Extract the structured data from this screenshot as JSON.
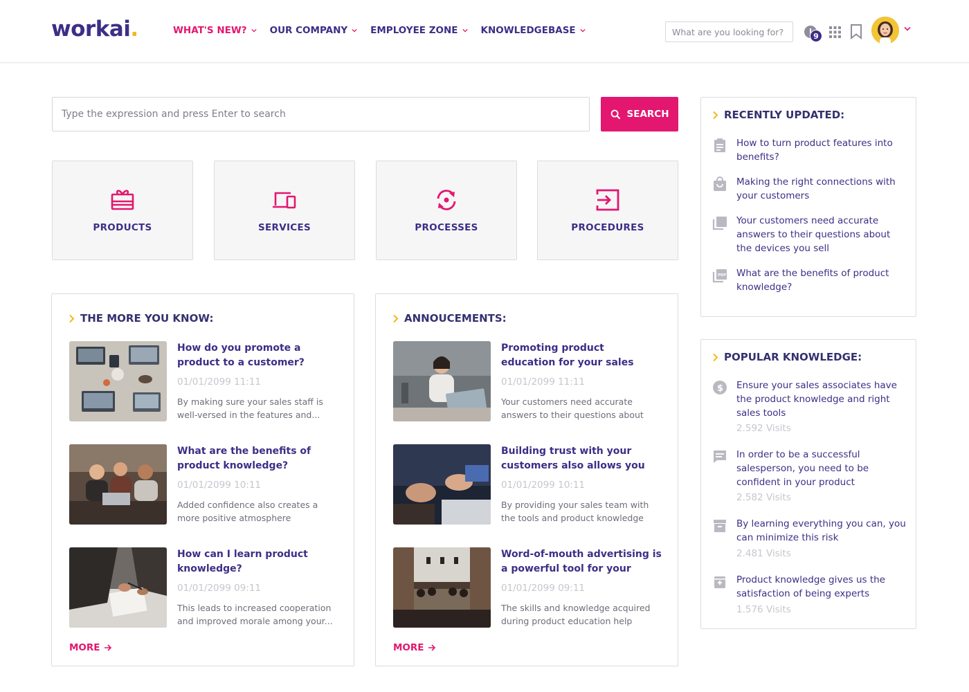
{
  "header": {
    "logo_text": "workai",
    "logo_dot": ".",
    "nav": [
      {
        "label": "WHAT'S NEW?"
      },
      {
        "label": "OUR COMPANY"
      },
      {
        "label": "EMPLOYEE ZONE"
      },
      {
        "label": "KNOWLEDGEBASE"
      }
    ],
    "search_placeholder": "What are you looking for?",
    "notification_count": "9"
  },
  "search": {
    "placeholder": "Type the expression and press Enter to search",
    "button_label": "SEARCH"
  },
  "categories": [
    {
      "label": "PRODUCTS",
      "icon": "gift-icon"
    },
    {
      "label": "SERVICES",
      "icon": "devices-icon"
    },
    {
      "label": "PROCESSES",
      "icon": "sync-icon"
    },
    {
      "label": "PROCEDURES",
      "icon": "login-icon"
    }
  ],
  "more_you_know": {
    "title": "THE MORE YOU KNOW:",
    "articles": [
      {
        "title": "How do you promote a product to a customer?",
        "date": "01/01/2099 11:11",
        "desc": "By making sure your sales staff is well-versed in the features and..."
      },
      {
        "title": "What are the benefits of product knowledge?",
        "date": "01/01/2099 10:11",
        "desc": "Added confidence also creates a more positive atmosphere throughout yo..."
      },
      {
        "title": "How can I learn product knowledge?",
        "date": "01/01/2099 09:11",
        "desc": "This leads to increased cooperation and improved morale among your..."
      }
    ],
    "more_label": "MORE"
  },
  "announcements": {
    "title": "ANNOUCEMENTS:",
    "articles": [
      {
        "title": "Promoting product education for your sales associates can pay o...",
        "date": "01/01/2099 11:11",
        "desc": "Your customers need accurate answers to their questions about th..."
      },
      {
        "title": "Building trust with your customers also allows you to...",
        "date": "01/01/2099 10:11",
        "desc": "By providing your sales team with the tools and product knowledge they..."
      },
      {
        "title": "Word-of-mouth advertising is a powerful tool for your business...",
        "date": "01/01/2099 09:11",
        "desc": "The skills and knowledge acquired during product education help your..."
      }
    ],
    "more_label": "MORE"
  },
  "recently_updated": {
    "title": "RECENTLY UPDATED:",
    "items": [
      {
        "text": "How to turn product features into benefits?",
        "icon": "clipboard-icon"
      },
      {
        "text": "Making the right connections with your customers",
        "icon": "shopping-bag-icon"
      },
      {
        "text": "Your customers need accurate answers to their questions about the devices you sell",
        "icon": "library-icon"
      },
      {
        "text": "What are the benefits of product knowledge?",
        "icon": "pdf-icon"
      }
    ]
  },
  "popular_knowledge": {
    "title": "POPULAR KNOWLEDGE:",
    "items": [
      {
        "text": "Ensure your sales associates have the product knowledge and right sales tools",
        "visits": "2.592 Visits",
        "icon": "dollar-icon"
      },
      {
        "text": "In order to be a successful salesperson, you need to be confident in your product",
        "visits": "2.582 Visits",
        "icon": "chat-icon"
      },
      {
        "text": "By learning everything you can, you can minimize this risk",
        "visits": "2.481 Visits",
        "icon": "archive-icon"
      },
      {
        "text": "Product knowledge gives us the satisfaction of being experts",
        "visits": "1.576 Visits",
        "icon": "inbox-icon"
      }
    ]
  },
  "colors": {
    "brand_primary": "#3b2f86",
    "accent_pink": "#e3176f",
    "accent_yellow": "#f5b81b"
  }
}
